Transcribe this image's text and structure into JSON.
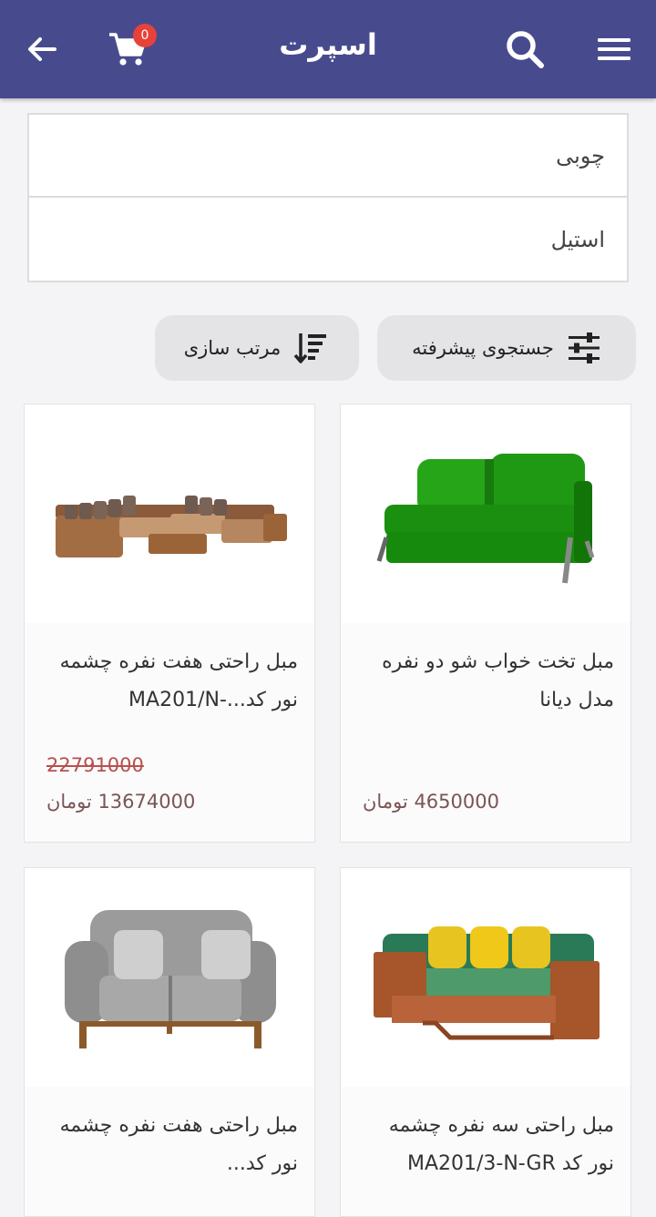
{
  "appbar": {
    "title": "اسپرت",
    "cart_count": "0",
    "icons": {
      "back": "arrow-back-icon",
      "cart": "cart-icon",
      "search": "search-icon",
      "menu": "hamburger-menu-icon"
    },
    "background": "#474b8e"
  },
  "filters": [
    {
      "label": "چوبی"
    },
    {
      "label": "استیل"
    }
  ],
  "actions": {
    "advanced_search": "جستجوی پیشرفته",
    "sort": "مرتب سازی"
  },
  "products": [
    {
      "name": "مبل تخت خواب شو دو نفره مدل دیانا",
      "old_price": "",
      "price": "4650000 تومان"
    },
    {
      "name": "مبل راحتی هفت نفره چشمه نور کد...-MA201/N",
      "old_price": "22791000",
      "price": "13674000 تومان"
    },
    {
      "name": "مبل راحتی سه نفره چشمه نور کد MA201/3-N-GR",
      "old_price": "",
      "price": ""
    },
    {
      "name": "مبل راحتی هفت نفره چشمه نور کد...",
      "old_price": "",
      "price": ""
    }
  ]
}
